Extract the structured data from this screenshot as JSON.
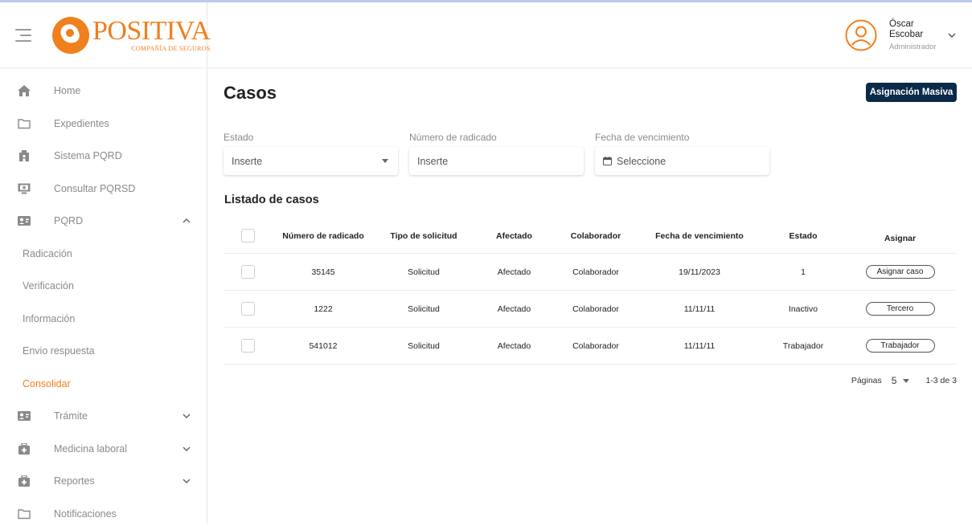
{
  "brand": {
    "name": "POSITIVA",
    "subtitle": "COMPAÑÍA DE SEGUROS"
  },
  "colors": {
    "accent": "#f07f1e",
    "primary_button": "#0b2a4a"
  },
  "sidebar": {
    "items": [
      {
        "label": "Home",
        "icon": "home-icon"
      },
      {
        "label": "Expedientes",
        "icon": "folder-icon"
      },
      {
        "label": "Sistema PQRD",
        "icon": "building-icon"
      },
      {
        "label": "Consultar PQRSD",
        "icon": "monitor-icon"
      },
      {
        "label": "PQRD",
        "icon": "id-card-icon",
        "expanded": true
      }
    ],
    "subitems": [
      {
        "label": "Radicación"
      },
      {
        "label": "Verificación"
      },
      {
        "label": "Información"
      },
      {
        "label": "Envio respuesta"
      },
      {
        "label": "Consolidar",
        "active": true
      }
    ],
    "items_after": [
      {
        "label": "Trámite",
        "icon": "id-card-icon"
      },
      {
        "label": "Medicina laboral",
        "icon": "medical-kit-icon"
      },
      {
        "label": "Reportes",
        "icon": "medical-kit-icon"
      },
      {
        "label": "Notificaciones",
        "icon": "folder-icon"
      }
    ]
  },
  "user": {
    "first_name": "Óscar",
    "last_name": "Escobar",
    "role": "Administrador"
  },
  "page": {
    "title": "Casos",
    "mass_button": "Asignación Masiva",
    "list_title": "Listado de casos"
  },
  "filters": {
    "estado": {
      "label": "Estado",
      "placeholder": "Inserte"
    },
    "radicado": {
      "label": "Número de radicado",
      "placeholder": "Inserte"
    },
    "fecha": {
      "label": "Fecha de vencimiento",
      "placeholder": "Seleccione"
    }
  },
  "table": {
    "headers": [
      "Número de radicado",
      "Tipo de solicitud",
      "Afectado",
      "Colaborador",
      "Fecha de vencimiento",
      "Estado",
      "Asignar"
    ],
    "rows": [
      {
        "numero": "35145",
        "tipo": "Solicitud",
        "afectado": "Afectado",
        "colaborador": "Colaborador",
        "fecha": "19/11/2023",
        "estado": "1",
        "asignar": "Asignar caso"
      },
      {
        "numero": "1222",
        "tipo": "Solicitud",
        "afectado": "Afectado",
        "colaborador": "Colaborador",
        "fecha": "11/11/11",
        "estado": "Inactivo",
        "asignar": "Tercero"
      },
      {
        "numero": "541012",
        "tipo": "Solicitud",
        "afectado": "Afectado",
        "colaborador": "Colaborador",
        "fecha": "11/11/11",
        "estado": "Trabajador",
        "asignar": "Trabajador"
      }
    ]
  },
  "pagination": {
    "label": "Páginas",
    "page_size": "5",
    "range": "1-3 de 3"
  }
}
